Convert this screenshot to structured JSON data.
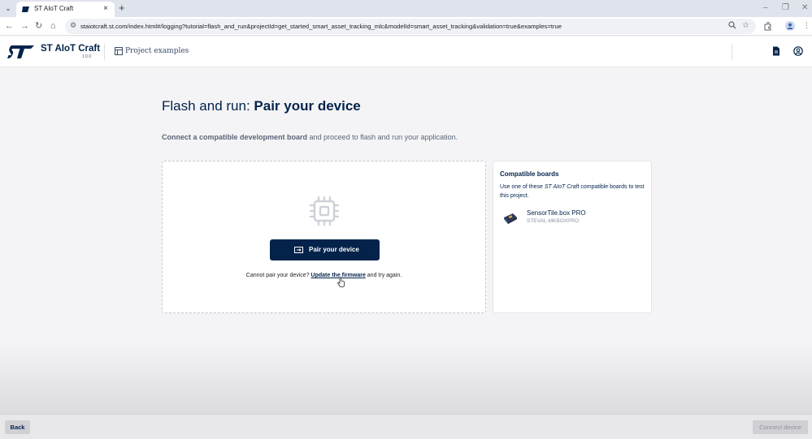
{
  "browser": {
    "tab_title": "ST AIoT Craft",
    "tab_close": "×",
    "new_tab": "+",
    "url": "staiotcraft.st.com/index.html#/logging?tutorial=flash_and_run&projectId=get_started_smart_asset_tracking_mlc&modelId=smart_asset_tracking&validation=true&examples=true",
    "nav": {
      "back": "←",
      "forward": "→",
      "reload": "↻",
      "home": "⌂"
    },
    "window": {
      "minimize": "–",
      "restore": "❐",
      "close": "✕"
    }
  },
  "header": {
    "brand": "ST AIoT Craft",
    "version": "1.0.0",
    "project_examples": "Project examples"
  },
  "main": {
    "title_prefix": "Flash and run: ",
    "title_emphasis": "Pair your device",
    "subtitle_bold": "Connect a compatible development board",
    "subtitle_rest": " and proceed to flash and run your application.",
    "pair_button": "Pair your device",
    "help_prefix": "Cannot pair your device? ",
    "help_link": "Update the firmware",
    "help_suffix": " and try again."
  },
  "boards": {
    "title": "Compatible boards",
    "desc_prefix": "Use one of these ",
    "desc_brand": "ST AIoT Craft",
    "desc_suffix": " compatible boards to test this project.",
    "items": [
      {
        "name": "SensorTile.box PRO",
        "code": "STEVAL-MKBOXPRO"
      }
    ]
  },
  "footer": {
    "back": "Back",
    "connect": "Connect device"
  },
  "colors": {
    "brand_navy": "#03234b",
    "background": "#f4f4f6"
  }
}
